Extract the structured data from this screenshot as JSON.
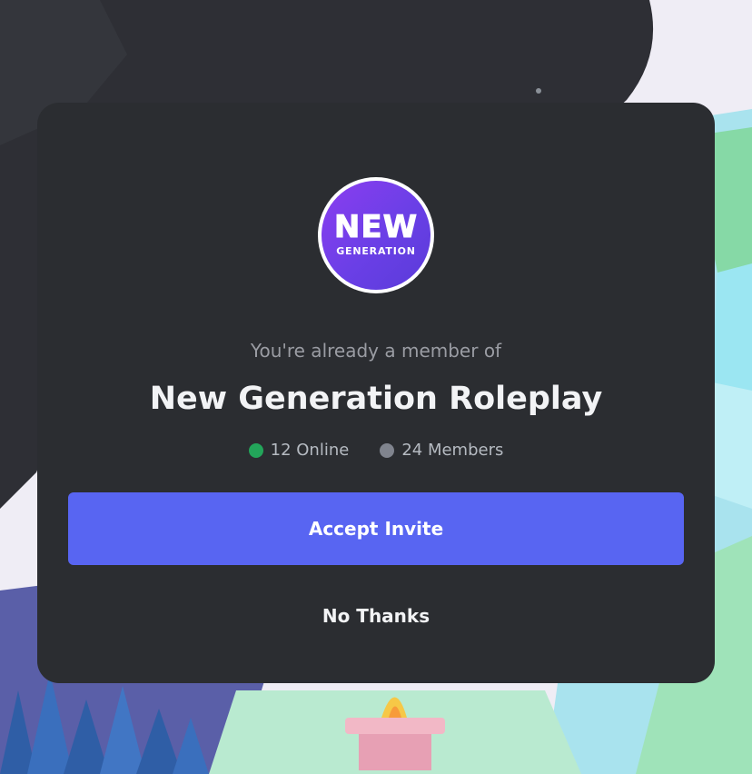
{
  "invite": {
    "server_icon": {
      "line1": "NEW",
      "line2": "GENERATION"
    },
    "subtitle": "You're already a member of",
    "server_name": "New Generation Roleplay",
    "online_text": "12 Online",
    "members_text": "24 Members",
    "accept_label": "Accept Invite",
    "decline_label": "No Thanks"
  },
  "colors": {
    "modal_bg": "#2b2d31",
    "accent": "#5865f2",
    "online": "#23a55a",
    "members": "#80848e"
  },
  "icons": {
    "online": "online-status-dot",
    "members": "members-status-dot"
  }
}
